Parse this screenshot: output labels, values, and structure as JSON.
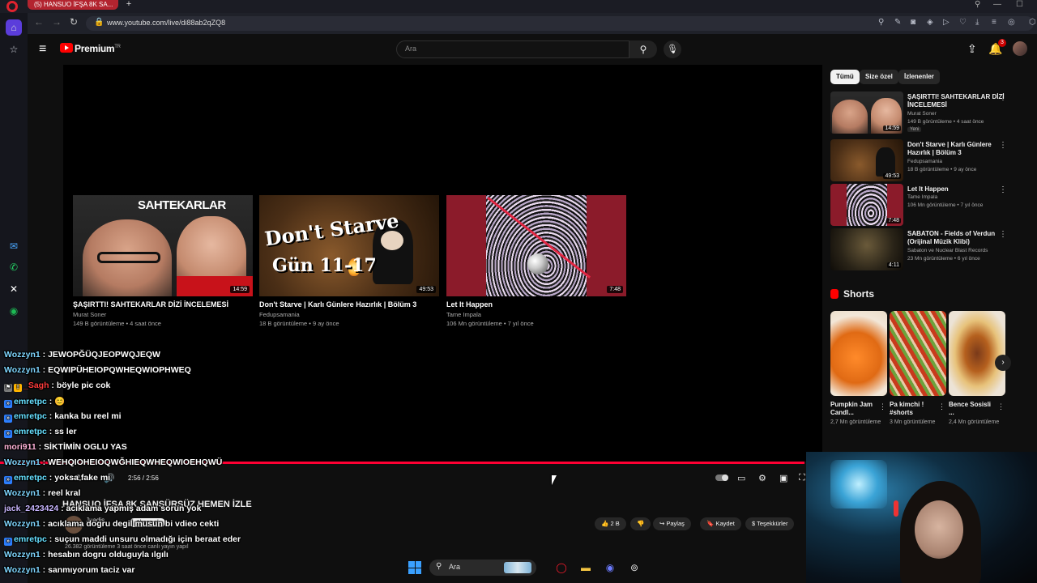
{
  "browser": {
    "tab_title": "(5) HANSUO İFŞA 8K SA...",
    "new_tab_icon": "plus-icon",
    "url": "www.youtube.com/live/di88ab2qZQ8",
    "sidebar_icons": [
      "opera-icon",
      "home-icon",
      "star-icon",
      "messenger-icon",
      "whatsapp-icon",
      "x-icon",
      "spotify-icon"
    ]
  },
  "youtube": {
    "brand": "Premium",
    "search_placeholder": "Ara",
    "notification_count": "3"
  },
  "player": {
    "time": "2:56 / 2:56",
    "progress_fraction": 1.0,
    "endcards": [
      {
        "title": "ŞAŞIRTTI! SAHTEKARLAR DİZİ İNCELEMESİ",
        "thumb_text": "SAHTEKARLAR",
        "channel": "Murat Soner",
        "meta": "149 B görüntüleme • 4 saat önce",
        "duration": "14:59"
      },
      {
        "title": "Don't Starve | Karlı Günlere Hazırlık | Bölüm 3",
        "thumb_text_1": "Don't Starve",
        "thumb_text_2": "Gün 11-17",
        "channel": "Fedupsamania",
        "meta": "18 B görüntüleme • 9 ay önce",
        "duration": "49:53"
      },
      {
        "title": "Let It Happen",
        "channel": "Tame Impala",
        "meta": "106 Mn görüntüleme • 7 yıl önce",
        "duration": "7:48"
      }
    ]
  },
  "video": {
    "title": "HANSUO İFŞA 8K SANSÜRSÜZ HEMEN İZLE",
    "channel": "Juadis",
    "subscribe": "Abone ol",
    "desc": "26.382 görüntüleme  3 saat önce canlı yayın yapıl",
    "actions": {
      "like": "2 B",
      "share": "Paylaş",
      "save": "Kaydet",
      "thanks": "Teşekkürler"
    }
  },
  "chat": [
    {
      "user": "Wozzyn1",
      "color": "#7fd6ff",
      "msg": "JEWOPĞÜQJEOPWQJEQW",
      "badges": []
    },
    {
      "user": "Wozzyn1",
      "color": "#7fd6ff",
      "msg": "EQWIPÜHEIOPQWHEQWIOPHWEQ",
      "badges": []
    },
    {
      "user": "_Sagh",
      "color": "#ff3b3b",
      "msg": "böyle pic cok",
      "badges": [
        "⚑",
        "!"
      ]
    },
    {
      "user": "emretpc",
      "color": "#66e0ff",
      "msg": "😊",
      "badges": [
        "»"
      ]
    },
    {
      "user": "emretpc",
      "color": "#66e0ff",
      "msg": "kanka bu reel mi",
      "badges": [
        "»"
      ]
    },
    {
      "user": "emretpc",
      "color": "#66e0ff",
      "msg": "ss ler",
      "badges": [
        "»"
      ]
    },
    {
      "user": "mori911",
      "color": "#ffb3d9",
      "msg": "SİKTİMİN OGLU YAS",
      "badges": []
    },
    {
      "user": "Wozzyn1",
      "color": "#7fd6ff",
      "msg": "WEHQIOHEIOQWĞHIEQWHEQWIOEHQWÜ",
      "badges": []
    },
    {
      "user": "emretpc",
      "color": "#66e0ff",
      "msg": "yoksa fake mi",
      "badges": [
        "»"
      ]
    },
    {
      "user": "Wozzyn1",
      "color": "#7fd6ff",
      "msg": "reel kral",
      "badges": []
    },
    {
      "user": "jack_2423424",
      "color": "#c9b6ff",
      "msg": "acıklama yapmış adam sorun yok",
      "badges": []
    },
    {
      "user": "Wozzyn1",
      "color": "#7fd6ff",
      "msg": "acıklama dogru degil musun bi vdieo cekti",
      "badges": []
    },
    {
      "user": "emretpc",
      "color": "#66e0ff",
      "msg": "suçun maddi unsuru olmadığı için beraat eder",
      "badges": [
        "»"
      ]
    },
    {
      "user": "Wozzyn1",
      "color": "#7fd6ff",
      "msg": "hesabın dogru olduguyla ılgılı",
      "badges": []
    },
    {
      "user": "Wozzyn1",
      "color": "#7fd6ff",
      "msg": "sanmıyorum taciz var",
      "badges": []
    }
  ],
  "sidebar": {
    "chips": [
      "Tümü",
      "Size özel",
      "İzlenenler"
    ],
    "recommendations": [
      {
        "title": "ŞAŞIRTTI! SAHTEKARLAR DİZİ İNCELEMESİ",
        "channel": "Murat Soner",
        "meta": "149 B görüntüleme • 4 saat önce",
        "badge": "Yeni",
        "duration": "14:59"
      },
      {
        "title": "Don't Starve | Karlı Günlere Hazırlık | Bölüm 3",
        "channel": "Fedupsamania",
        "meta": "18 B görüntüleme • 9 ay önce",
        "duration": "49:53"
      },
      {
        "title": "Let It Happen",
        "channel": "Tame Impala",
        "meta": "106 Mn görüntüleme • 7 yıl önce",
        "duration": "7:48"
      },
      {
        "title": "SABATON - Fields of Verdun (Orijinal Müzik Klibi)",
        "channel": "Sabaton ve Nuclear Blast Records",
        "meta": "23 Mn görüntüleme • 6 yıl önce",
        "duration": "4:11"
      }
    ],
    "shorts_title": "Shorts",
    "shorts": [
      {
        "title": "Pumpkin Jam Candl...",
        "views": "2,7 Mn görüntüleme"
      },
      {
        "title": "Pa kimchi ! #shorts",
        "views": "3 Mn görüntüleme"
      },
      {
        "title": "Bence Sosisli ...",
        "views": "2,4 Mn görüntüleme"
      }
    ]
  },
  "taskbar": {
    "search_label": "Ara"
  }
}
